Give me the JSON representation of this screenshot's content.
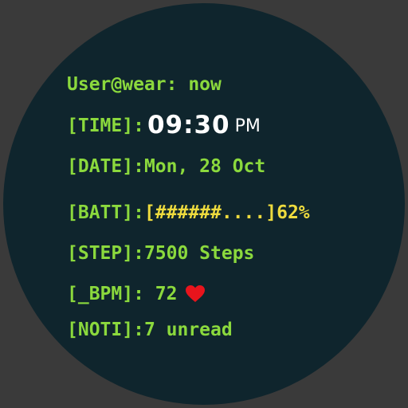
{
  "header": {
    "prompt": "User@wear: now"
  },
  "time": {
    "tag": "[TIME]:",
    "value": "09:30",
    "ampm": "PM"
  },
  "date": {
    "tag": "[DATE]:",
    "value": "Mon, 28 Oct"
  },
  "battery": {
    "tag": "[BATT]:",
    "bar": "[######....]",
    "percent": "62%",
    "level": 0.62
  },
  "steps": {
    "tag": "[STEP]:",
    "value": "7500 Steps"
  },
  "heart_rate": {
    "tag": "[_BPM]:",
    "value": "72",
    "icon": "heart-icon"
  },
  "notifications": {
    "tag": "[NOTI]:",
    "value": "7 unread"
  },
  "colors": {
    "background": "#3a3a3a",
    "dial": "#0f252d",
    "green": "#8bd93d",
    "yellow": "#eedb3e",
    "white": "#ffffff",
    "heart": "#e8141c"
  }
}
